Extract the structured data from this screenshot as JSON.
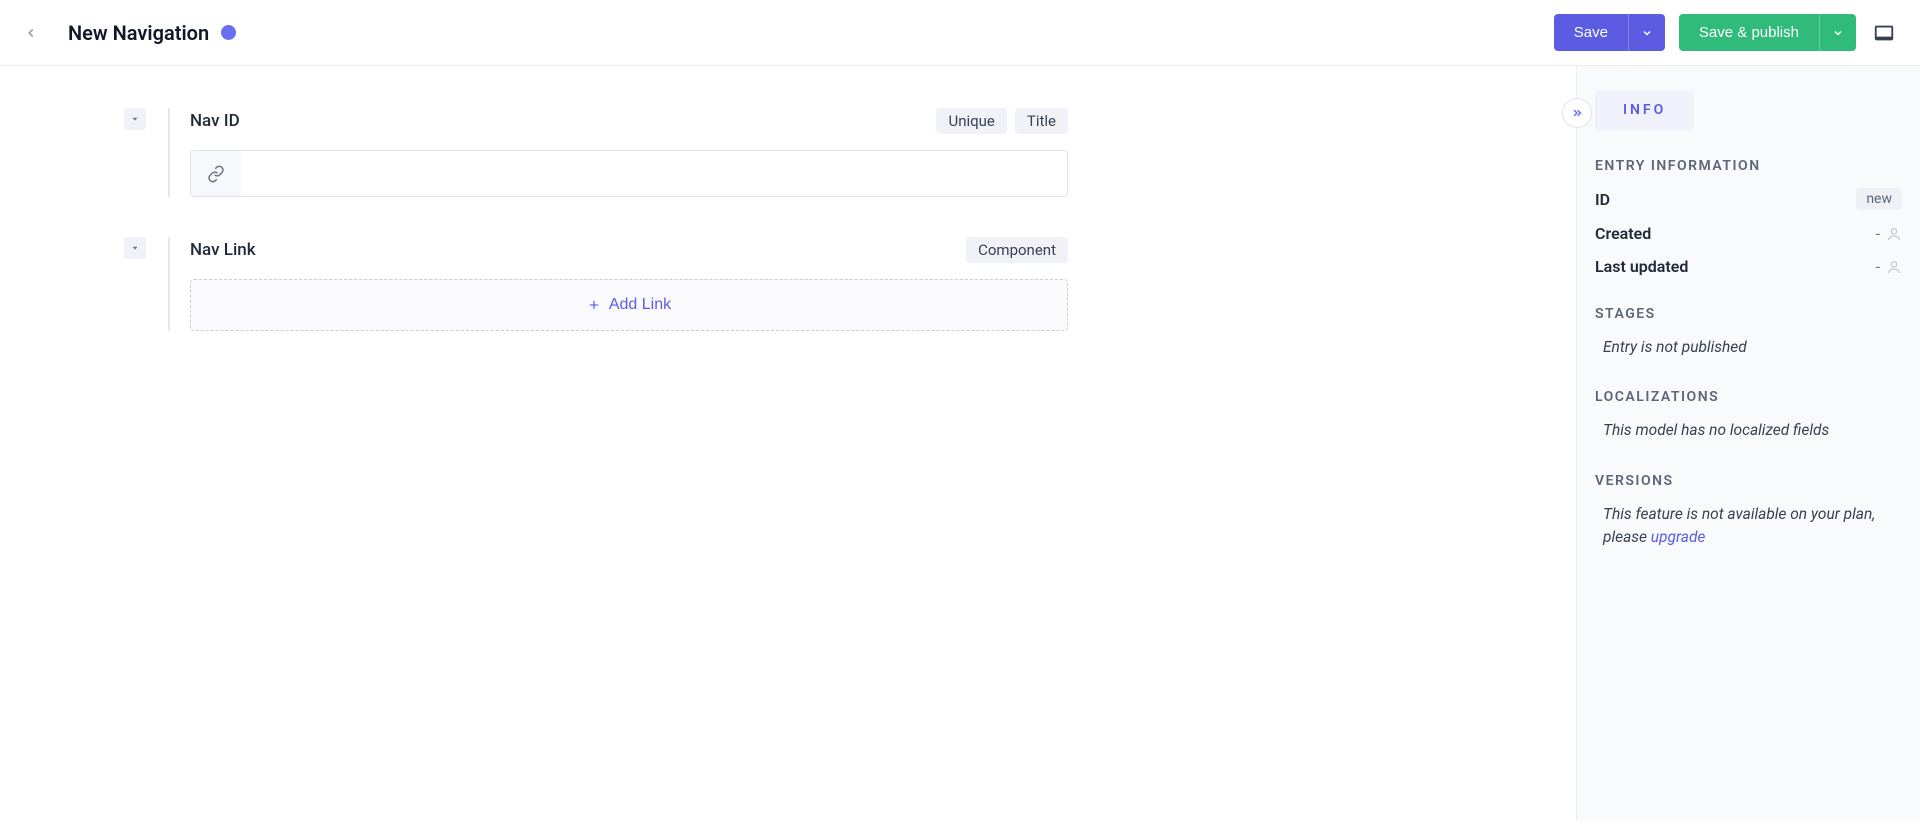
{
  "header": {
    "title": "New Navigation",
    "save_label": "Save",
    "publish_label": "Save & publish"
  },
  "fields": {
    "nav_id": {
      "label": "Nav ID",
      "badges": [
        "Unique",
        "Title"
      ],
      "value": ""
    },
    "nav_link": {
      "label": "Nav Link",
      "badges": [
        "Component"
      ],
      "add_button": "Add Link"
    }
  },
  "sidebar": {
    "tab": "INFO",
    "entry_info": {
      "title": "ENTRY INFORMATION",
      "id_label": "ID",
      "id_value": "new",
      "created_label": "Created",
      "created_value": "-",
      "updated_label": "Last updated",
      "updated_value": "-"
    },
    "stages": {
      "title": "STAGES",
      "body": "Entry is not published"
    },
    "localizations": {
      "title": "LOCALIZATIONS",
      "body": "This model has no localized fields"
    },
    "versions": {
      "title": "VERSIONS",
      "body_prefix": "This feature is not available on your plan, please ",
      "upgrade_label": "upgrade"
    }
  }
}
